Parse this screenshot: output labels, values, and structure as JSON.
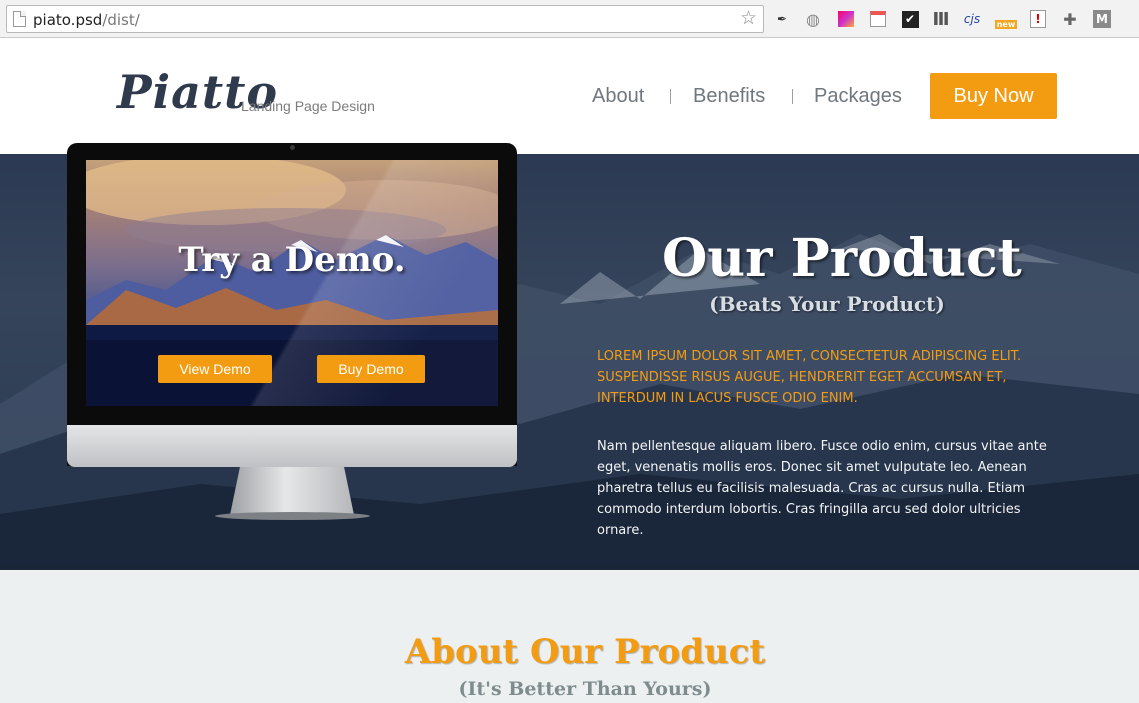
{
  "browser": {
    "url_host": "piato.psd",
    "url_path": "/dist/",
    "extensions": [
      "eyedropper-icon",
      "globe-icon",
      "color-picker-icon",
      "notes-icon",
      "checklist-icon",
      "bars-icon",
      "cjs",
      "new",
      "alert-icon",
      "puzzle-icon",
      "M"
    ]
  },
  "header": {
    "logo": "Piatto",
    "tagline": "Landing Page Design",
    "nav": [
      "About",
      "Benefits",
      "Packages"
    ],
    "cta": "Buy Now"
  },
  "hero": {
    "monitor": {
      "title": "Try a Demo.",
      "view_demo": "View Demo",
      "buy_demo": "Buy Demo"
    },
    "title": "Our Product",
    "subtitle": "(Beats Your Product)",
    "lead": "LOREM IPSUM DOLOR SIT AMET, CONSECTETUR ADIPISCING ELIT. SUSPENDISSE RISUS AUGUE, HENDRERIT EGET ACCUMSAN ET, INTERDUM IN LACUS FUSCE ODIO ENIM.",
    "body": "Nam pellentesque aliquam libero. Fusce odio enim, cursus vitae ante eget, venenatis mollis eros. Donec sit amet vulputate leo. Aenean pharetra tellus eu facilisis malesuada. Cras ac cursus nulla. Etiam commodo interdum lobortis. Cras fringilla arcu sed dolor ultricies ornare."
  },
  "about": {
    "title": "About Our Product",
    "subtitle": "(It's Better Than Yours)"
  },
  "colors": {
    "accent": "#f39c12",
    "navy": "#2c3e50",
    "text_gray": "#7f8c8d"
  }
}
